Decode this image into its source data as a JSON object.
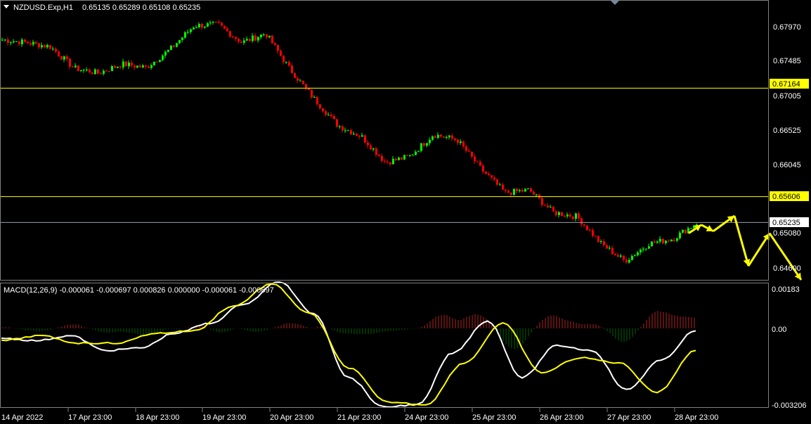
{
  "header": {
    "symbol": "NZDUSD.Exp,H1",
    "ohlc": "0.65135 0.65289 0.65108 0.65235"
  },
  "macd": {
    "label": "MACD(12,26,9) -0.000061 -0.000697 0.000826 0.000000 -0.000061 -0.000697"
  },
  "price_axis": {
    "ticks": [
      "0.67970",
      "0.67485",
      "0.67005",
      "0.66525",
      "0.66045",
      "0.65080",
      "0.64600"
    ]
  },
  "macd_axis": {
    "ticks": [
      "0.00183",
      "0.00",
      "-0.003206"
    ]
  },
  "levels": {
    "upper": "0.67164",
    "lower": "0.65606",
    "current": "0.65235"
  },
  "time_axis": {
    "labels": [
      "14 Apr 2022",
      "17 Apr 23:00",
      "18 Apr 23:00",
      "19 Apr 23:00",
      "20 Apr 23:00",
      "21 Apr 23:00",
      "24 Apr 23:00",
      "25 Apr 23:00",
      "26 Apr 23:00",
      "27 Apr 23:00",
      "28 Apr 23:00"
    ]
  },
  "colors": {
    "bull": "#00ff00",
    "bear": "#ff0000",
    "level": "#ffff00",
    "current": "#c0c0c0",
    "macd_line": "#ffffff",
    "signal_line": "#ffff00",
    "hist_pos": "#b22222",
    "hist_neg": "#006400"
  },
  "chart_data": {
    "type": "candlestick",
    "symbol": "NZDUSD.Exp",
    "timeframe": "H1",
    "price_range": [
      0.6441,
      0.6843
    ],
    "close_path": [
      {
        "x": "14 Apr 2022",
        "close": 0.6786
      },
      {
        "x": "15 Apr",
        "close": 0.6782
      },
      {
        "x": "17 Apr 23:00",
        "close": 0.6776
      },
      {
        "x": "18 Apr 03:00",
        "close": 0.6745
      },
      {
        "x": "18 Apr 23:00",
        "close": 0.6738
      },
      {
        "x": "19 Apr 10:00",
        "close": 0.6751
      },
      {
        "x": "19 Apr 18:00",
        "close": 0.6746
      },
      {
        "x": "19 Apr 23:00",
        "close": 0.6772
      },
      {
        "x": "20 Apr 06:00",
        "close": 0.6806
      },
      {
        "x": "20 Apr 12:00",
        "close": 0.6808
      },
      {
        "x": "20 Apr 16:00",
        "close": 0.6782
      },
      {
        "x": "20 Apr 23:00",
        "close": 0.6795
      },
      {
        "x": "21 Apr 05:00",
        "close": 0.6744
      },
      {
        "x": "21 Apr 23:00",
        "close": 0.6702
      },
      {
        "x": "22 Apr 05:00",
        "close": 0.6663
      },
      {
        "x": "24 Apr 12:00",
        "close": 0.6647
      },
      {
        "x": "24 Apr 23:00",
        "close": 0.661
      },
      {
        "x": "25 Apr 05:00",
        "close": 0.6618
      },
      {
        "x": "25 Apr 23:00",
        "close": 0.665
      },
      {
        "x": "26 Apr 05:00",
        "close": 0.6642
      },
      {
        "x": "26 Apr 12:00",
        "close": 0.66
      },
      {
        "x": "26 Apr 23:00",
        "close": 0.6566
      },
      {
        "x": "27 Apr 04:00",
        "close": 0.657
      },
      {
        "x": "27 Apr 10:00",
        "close": 0.6538
      },
      {
        "x": "27 Apr 16:00",
        "close": 0.6532
      },
      {
        "x": "27 Apr 23:00",
        "close": 0.6493
      },
      {
        "x": "28 Apr 03:00",
        "close": 0.6468
      },
      {
        "x": "28 Apr 09:00",
        "close": 0.6493
      },
      {
        "x": "28 Apr 16:00",
        "close": 0.65
      },
      {
        "x": "28 Apr 23:00",
        "close": 0.6523
      }
    ],
    "horizontal_lines": [
      0.67164,
      0.65606,
      0.65235
    ],
    "projection_arrow": [
      0.652,
      0.6511,
      0.6533,
      0.6461,
      0.6508,
      0.6441
    ],
    "macd_range": [
      -0.003206,
      0.00183
    ],
    "macd_line": [
      -0.0004,
      -0.0005,
      -0.0003,
      -0.0009,
      -0.0008,
      -0.0002,
      0.0002,
      0.001,
      0.0019,
      0.0006,
      -0.002,
      -0.0032,
      -0.0031,
      -0.001,
      0.0003,
      -0.002,
      -0.0007,
      -0.0009,
      -0.0025,
      -0.0013,
      -0.0001
    ],
    "signal_line": [
      -0.0005,
      -0.0003,
      -0.0006,
      -0.0006,
      -0.0002,
      -0.0001,
      0.0009,
      0.0018,
      0.0006,
      -0.0016,
      -0.003,
      -0.0031,
      -0.0014,
      0.0002,
      -0.0018,
      -0.0012,
      -0.0014,
      -0.0026,
      -0.0009
    ]
  }
}
